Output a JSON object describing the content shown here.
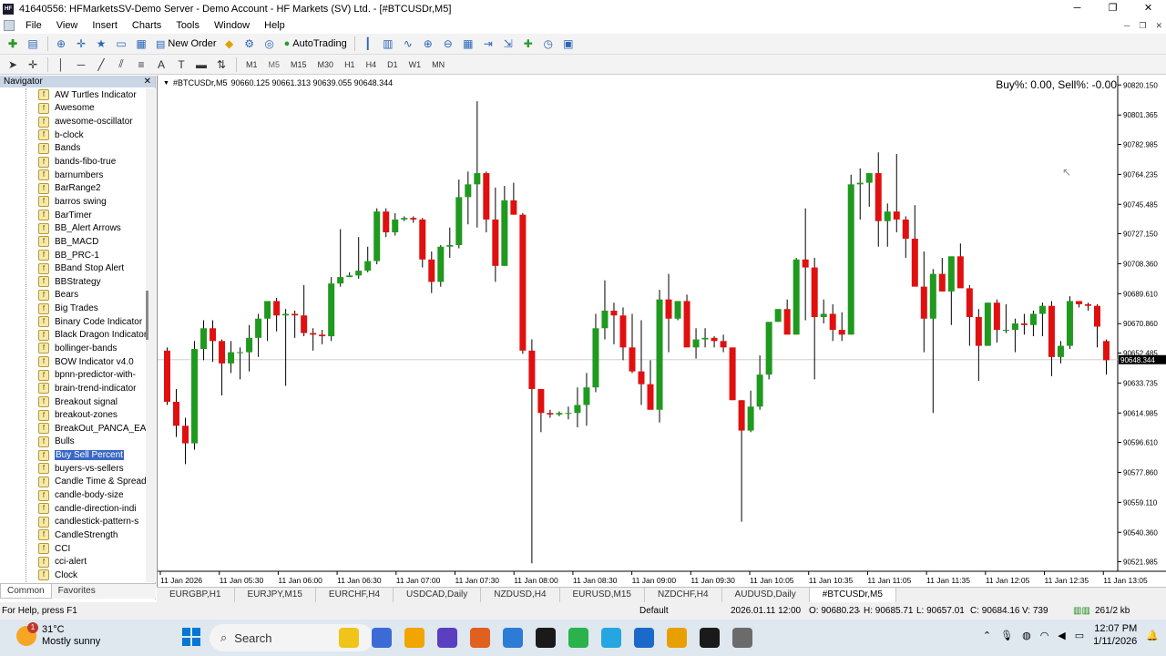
{
  "window": {
    "title": "41640556: HFMarketsSV-Demo Server - Demo Account - HF Markets (SV) Ltd. - [#BTCUSDr,M5]",
    "min_label": "─",
    "max_label": "❐",
    "close_label": "✕"
  },
  "menu": [
    "File",
    "View",
    "Insert",
    "Charts",
    "Tools",
    "Window",
    "Help"
  ],
  "toolbar": {
    "new_order": "New Order",
    "autotrading": "AutoTrading",
    "timeframes": [
      "M1",
      "M5",
      "M15",
      "M30",
      "H1",
      "H4",
      "D1",
      "W1",
      "MN"
    ]
  },
  "navigator": {
    "title": "Navigator",
    "close_label": "✕",
    "items": [
      "AW Turtles Indicator",
      "Awesome",
      "awesome-oscillator",
      "b-clock",
      "Bands",
      "bands-fibo-true",
      "barnumbers",
      "BarRange2",
      "barros swing",
      "BarTimer",
      "BB_Alert Arrows",
      "BB_MACD",
      "BB_PRC-1",
      "BBand Stop Alert",
      "BBStrategy",
      "Bears",
      "Big Trades",
      "Binary Code Indicator",
      "Black Dragon Indicator",
      "bollinger-bands",
      "BOW Indicator v4.0",
      "bpnn-predictor-with-",
      "brain-trend-indicator",
      "Breakout signal",
      "breakout-zones",
      "BreakOut_PANCA_EA",
      "Bulls",
      "Buy Sell Percent",
      "buyers-vs-sellers",
      "Candle Time & Spread",
      "candle-body-size",
      "candle-direction-indi",
      "candlestick-pattern-s",
      "CandleStrength",
      "CCI",
      "cci-alert",
      "Clock"
    ],
    "selected_index": 27,
    "tabs": [
      "Common",
      "Favorites"
    ]
  },
  "chart": {
    "symbol_info": "#BTCUSDr,M5",
    "ohlc": "90660.125 90661.313 90639.055 90648.344",
    "indicator_text": "Buy%: 0.00, Sell%: -0.00",
    "current_price": "90648.344",
    "tabs": [
      "EURGBP,H1",
      "EURJPY,M15",
      "EURCHF,H4",
      "USDCAD,Daily",
      "NZDUSD,H4",
      "EURUSD,M15",
      "NZDCHF,H4",
      "AUDUSD,Daily",
      "#BTCUSDr,M5"
    ],
    "active_tab": 8
  },
  "chart_data": {
    "type": "candlestick",
    "y_ticks": [
      "90820.150",
      "90801.365",
      "90782.985",
      "90764.235",
      "90745.485",
      "90727.150",
      "90708.360",
      "90689.610",
      "90670.860",
      "90652.485",
      "90633.735",
      "90614.985",
      "90596.610",
      "90577.860",
      "90559.110",
      "90540.360",
      "90521.985"
    ],
    "x_ticks": [
      "11 Jan 2026",
      "11 Jan 05:30",
      "11 Jan 06:00",
      "11 Jan 06:30",
      "11 Jan 07:00",
      "11 Jan 07:30",
      "11 Jan 08:00",
      "11 Jan 08:30",
      "11 Jan 09:00",
      "11 Jan 09:30",
      "11 Jan 10:05",
      "11 Jan 10:35",
      "11 Jan 11:05",
      "11 Jan 11:35",
      "11 Jan 12:05",
      "11 Jan 12:35",
      "11 Jan 13:05"
    ],
    "ylim": [
      90516,
      90826
    ],
    "bull_color": "#1f9a1f",
    "bear_color": "#e01010",
    "candles": [
      [
        90654,
        90656,
        90620,
        90622
      ],
      [
        90622,
        90630,
        90600,
        90607
      ],
      [
        90607,
        90612,
        90583,
        90596
      ],
      [
        90596,
        90660,
        90592,
        90655
      ],
      [
        90655,
        90673,
        90648,
        90668
      ],
      [
        90668,
        90673,
        90647,
        90660
      ],
      [
        90660,
        90661,
        90626,
        90646
      ],
      [
        90646,
        90660,
        90640,
        90653
      ],
      [
        90653,
        90656,
        90636,
        90653
      ],
      [
        90653,
        90670,
        90641,
        90662
      ],
      [
        90662,
        90677,
        90650,
        90674
      ],
      [
        90674,
        90683,
        90660,
        90685
      ],
      [
        90685,
        90687,
        90666,
        90676
      ],
      [
        90676,
        90680,
        90632,
        90677
      ],
      [
        90677,
        90679,
        90662,
        90676
      ],
      [
        90676,
        90695,
        90663,
        90665
      ],
      [
        90665,
        90668,
        90654,
        90664
      ],
      [
        90664,
        90667,
        90658,
        90663
      ],
      [
        90663,
        90700,
        90660,
        90696
      ],
      [
        90696,
        90730,
        90694,
        90700
      ],
      [
        90700,
        90703,
        90700,
        90701
      ],
      [
        90701,
        90725,
        90699,
        90704
      ],
      [
        90704,
        90719,
        90703,
        90710
      ],
      [
        90710,
        90743,
        90708,
        90741
      ],
      [
        90741,
        90743,
        90725,
        90728
      ],
      [
        90728,
        90740,
        90726,
        90736
      ],
      [
        90736,
        90738,
        90735,
        90737
      ],
      [
        90737,
        90738,
        90734,
        90736
      ],
      [
        90736,
        90737,
        90706,
        90711
      ],
      [
        90711,
        90716,
        90690,
        90697
      ],
      [
        90697,
        90720,
        90694,
        90719
      ],
      [
        90719,
        90731,
        90712,
        90720
      ],
      [
        90720,
        90761,
        90718,
        90750
      ],
      [
        90750,
        90766,
        90733,
        90758
      ],
      [
        90758,
        90810,
        90731,
        90765
      ],
      [
        90765,
        90766,
        90728,
        90736
      ],
      [
        90736,
        90756,
        90697,
        90707
      ],
      [
        90707,
        90757,
        90707,
        90748
      ],
      [
        90748,
        90759,
        90742,
        90739
      ],
      [
        90739,
        90740,
        90652,
        90654
      ],
      [
        90654,
        90661,
        90521,
        90630
      ],
      [
        90630,
        90620,
        90603,
        90615
      ],
      [
        90615,
        90617,
        90612,
        90614
      ],
      [
        90614,
        90616,
        90613,
        90615
      ],
      [
        90615,
        90619,
        90611,
        90615
      ],
      [
        90615,
        90631,
        90606,
        90620
      ],
      [
        90620,
        90640,
        90607,
        90631
      ],
      [
        90631,
        90677,
        90628,
        90668
      ],
      [
        90668,
        90698,
        90661,
        90679
      ],
      [
        90679,
        90684,
        90658,
        90676
      ],
      [
        90676,
        90681,
        90648,
        90656
      ],
      [
        90656,
        90677,
        90640,
        90641
      ],
      [
        90641,
        90673,
        90620,
        90633
      ],
      [
        90633,
        90648,
        90619,
        90617
      ],
      [
        90617,
        90692,
        90609,
        90686
      ],
      [
        90686,
        90702,
        90653,
        90674
      ],
      [
        90674,
        90685,
        90673,
        90685
      ],
      [
        90685,
        90689,
        90663,
        90656
      ],
      [
        90656,
        90668,
        90649,
        90661
      ],
      [
        90661,
        90668,
        90656,
        90662
      ],
      [
        90662,
        90663,
        90656,
        90660
      ],
      [
        90660,
        90664,
        90653,
        90656
      ],
      [
        90656,
        90653,
        90623,
        90623
      ],
      [
        90623,
        90623,
        90547,
        90604
      ],
      [
        90604,
        90629,
        90603,
        90619
      ],
      [
        90619,
        90651,
        90617,
        90639
      ],
      [
        90639,
        90670,
        90636,
        90672
      ],
      [
        90672,
        90680,
        90672,
        90680
      ],
      [
        90680,
        90686,
        90671,
        90664
      ],
      [
        90664,
        90712,
        90664,
        90711
      ],
      [
        90711,
        90743,
        90673,
        90706
      ],
      [
        90706,
        90712,
        90636,
        90675
      ],
      [
        90675,
        90686,
        90671,
        90677
      ],
      [
        90677,
        90683,
        90660,
        90667
      ],
      [
        90667,
        90678,
        90660,
        90664
      ],
      [
        90664,
        90764,
        90664,
        90758
      ],
      [
        90758,
        90768,
        90736,
        90759
      ],
      [
        90759,
        90761,
        90744,
        90765
      ],
      [
        90765,
        90778,
        90719,
        90735
      ],
      [
        90735,
        90746,
        90719,
        90741
      ],
      [
        90741,
        90777,
        90728,
        90736
      ],
      [
        90736,
        90738,
        90712,
        90724
      ],
      [
        90724,
        90745,
        90707,
        90694
      ],
      [
        90694,
        90716,
        90653,
        90674
      ],
      [
        90674,
        90705,
        90615,
        90702
      ],
      [
        90702,
        90712,
        90691,
        90691
      ],
      [
        90691,
        90700,
        90670,
        90713
      ],
      [
        90713,
        90721,
        90703,
        90693
      ],
      [
        90693,
        90695,
        90657,
        90675
      ],
      [
        90675,
        90680,
        90635,
        90657
      ],
      [
        90657,
        90684,
        90657,
        90684
      ],
      [
        90684,
        90686,
        90659,
        90667
      ],
      [
        90667,
        90683,
        90665,
        90667
      ],
      [
        90667,
        90674,
        90653,
        90671
      ],
      [
        90671,
        90677,
        90664,
        90670
      ],
      [
        90670,
        90679,
        90663,
        90677
      ],
      [
        90677,
        90684,
        90663,
        90682
      ],
      [
        90682,
        90685,
        90638,
        90650
      ],
      [
        90650,
        90660,
        90646,
        90657
      ],
      [
        90657,
        90688,
        90655,
        90685
      ],
      [
        90685,
        90684,
        90681,
        90683
      ],
      [
        90683,
        90684,
        90679,
        90682
      ],
      [
        90682,
        90683,
        90656,
        90669
      ],
      [
        90660,
        90661,
        90639,
        90648
      ]
    ]
  },
  "status": {
    "help": "For Help, press F1",
    "profile": "Default",
    "datetime": "2026.01.11 12:00",
    "open": "O: 90680.234",
    "high": "H: 90685.719",
    "low": "L: 90657.016",
    "close": "C: 90684.164",
    "volume": "V: 739",
    "traffic": "261/2 kb"
  },
  "taskbar": {
    "temp": "31°C",
    "weather": "Mostly sunny",
    "badge": "1",
    "search": "Search",
    "time": "12:07 PM",
    "date": "1/11/2026",
    "apps": [
      "#f0c419",
      "#3d6bd6",
      "#f0a500",
      "#5a3fc0",
      "#e06020",
      "#2c7cd6",
      "#1a1a1a",
      "#2ab34a",
      "#26a6e0",
      "#1b6ac9",
      "#e8a000",
      "#1a1a1a",
      "#6b6b6b"
    ]
  }
}
